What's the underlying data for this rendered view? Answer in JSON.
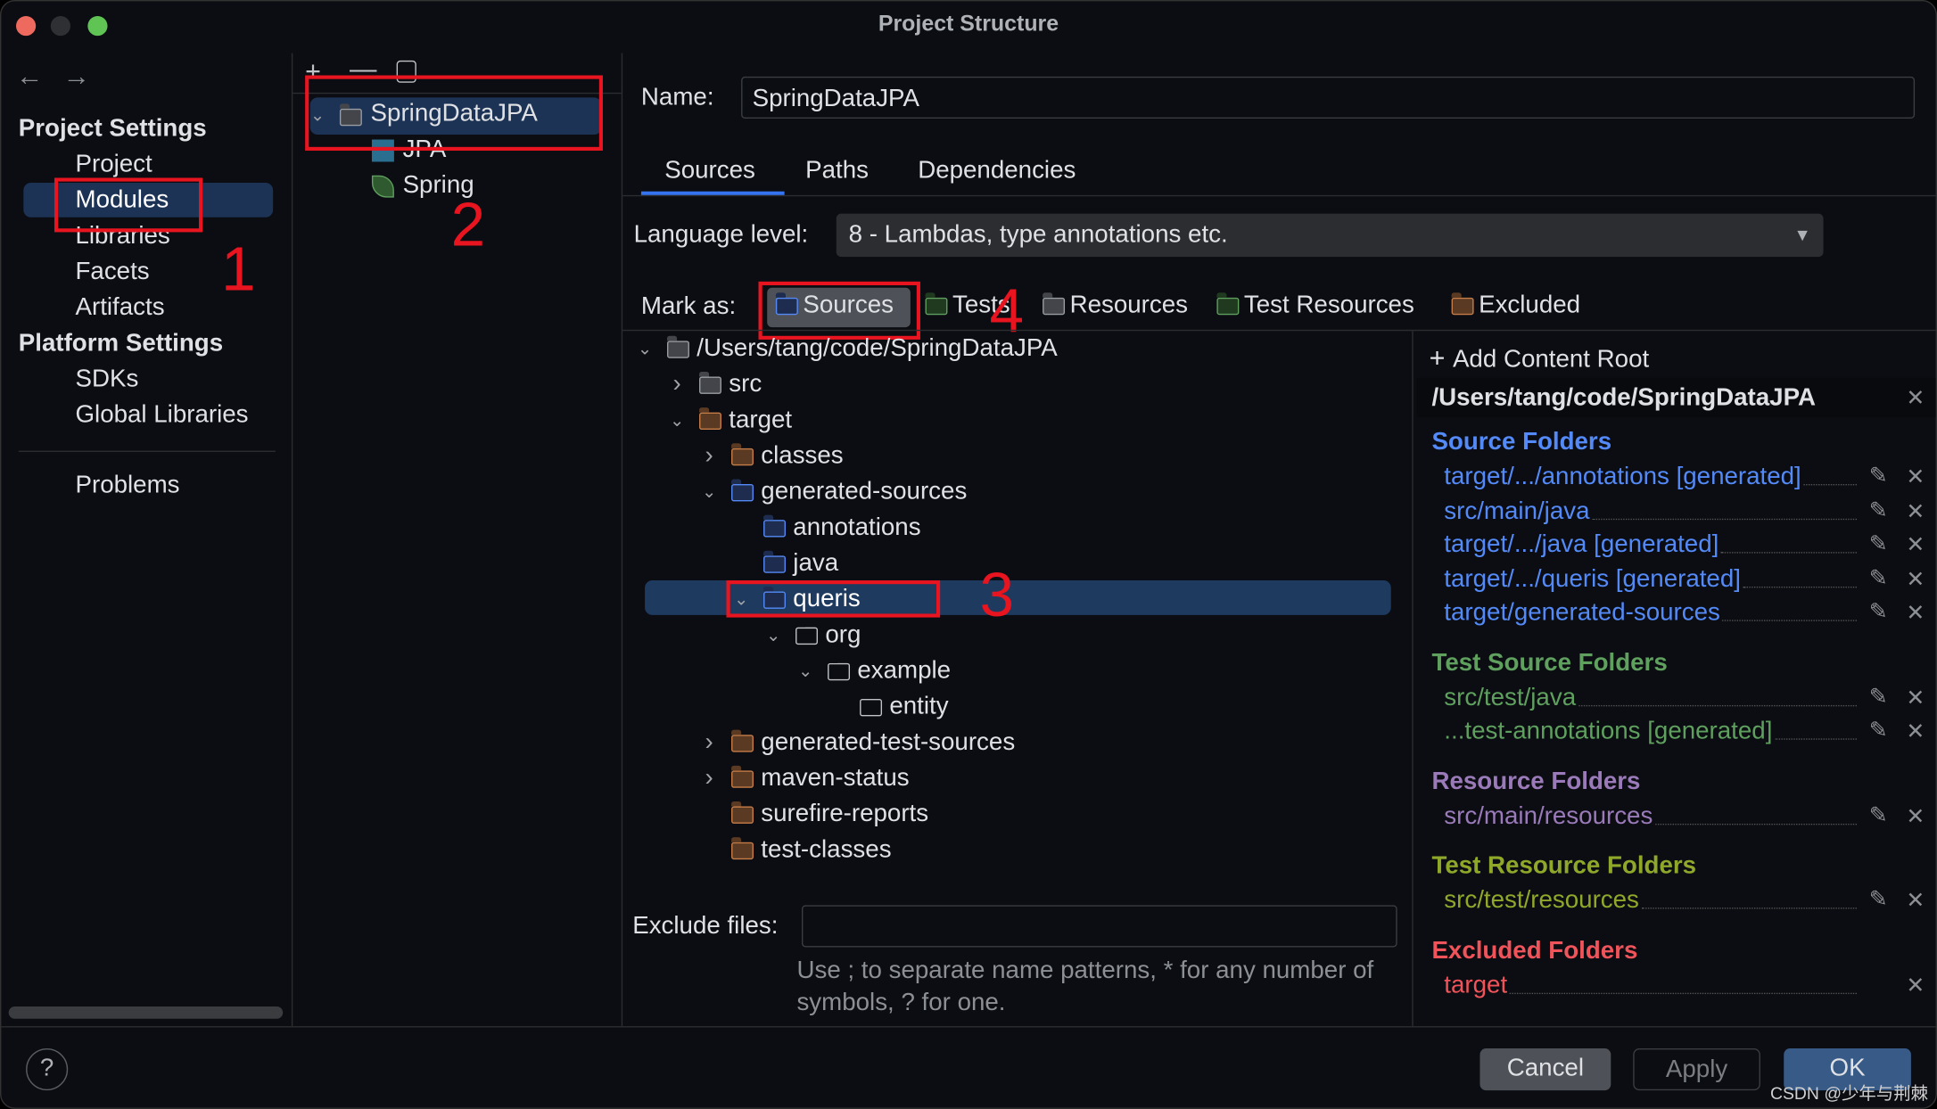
{
  "window": {
    "title": "Project Structure"
  },
  "sidebar": {
    "project_settings_header": "Project Settings",
    "project_items": [
      {
        "label": "Project"
      },
      {
        "label": "Modules",
        "selected": true
      },
      {
        "label": "Libraries"
      },
      {
        "label": "Facets"
      },
      {
        "label": "Artifacts"
      }
    ],
    "platform_settings_header": "Platform Settings",
    "platform_items": [
      {
        "label": "SDKs"
      },
      {
        "label": "Global Libraries"
      }
    ],
    "problems": "Problems"
  },
  "modules": {
    "items": [
      {
        "label": "SpringDataJPA",
        "selected": true
      },
      {
        "label": "JPA"
      },
      {
        "label": "Spring"
      }
    ]
  },
  "annotations": [
    "1",
    "2",
    "3",
    "4"
  ],
  "main": {
    "name_label": "Name:",
    "name_value": "SpringDataJPA",
    "tabs": [
      {
        "label": "Sources",
        "active": true
      },
      {
        "label": "Paths"
      },
      {
        "label": "Dependencies"
      }
    ],
    "language_label": "Language level:",
    "language_value": "8 - Lambdas, type annotations etc.",
    "mark_as_label": "Mark as:",
    "mark_buttons": [
      "Sources",
      "Tests",
      "Resources",
      "Test Resources",
      "Excluded"
    ],
    "tree": [
      {
        "label": "/Users/tang/code/SpringDataJPA",
        "depth": 0,
        "state": "expanded",
        "icon": "folder"
      },
      {
        "label": "src",
        "depth": 1,
        "state": "collapsed",
        "icon": "folder"
      },
      {
        "label": "target",
        "depth": 1,
        "state": "expanded",
        "icon": "excluded-folder"
      },
      {
        "label": "classes",
        "depth": 2,
        "state": "collapsed",
        "icon": "excluded-folder"
      },
      {
        "label": "generated-sources",
        "depth": 2,
        "state": "expanded",
        "icon": "source-folder"
      },
      {
        "label": "annotations",
        "depth": 3,
        "state": "leaf",
        "icon": "generated-source-folder"
      },
      {
        "label": "java",
        "depth": 3,
        "state": "leaf",
        "icon": "generated-source-folder"
      },
      {
        "label": "queris",
        "depth": 3,
        "state": "expanded",
        "icon": "generated-source-folder",
        "selected": true
      },
      {
        "label": "org",
        "depth": 4,
        "state": "expanded",
        "icon": "package"
      },
      {
        "label": "example",
        "depth": 5,
        "state": "expanded",
        "icon": "package"
      },
      {
        "label": "entity",
        "depth": 6,
        "state": "leaf",
        "icon": "package"
      },
      {
        "label": "generated-test-sources",
        "depth": 2,
        "state": "collapsed",
        "icon": "excluded-folder"
      },
      {
        "label": "maven-status",
        "depth": 2,
        "state": "collapsed",
        "icon": "excluded-folder"
      },
      {
        "label": "surefire-reports",
        "depth": 2,
        "state": "leaf",
        "icon": "excluded-folder"
      },
      {
        "label": "test-classes",
        "depth": 2,
        "state": "leaf",
        "icon": "excluded-folder"
      }
    ],
    "exclude_label": "Exclude files:",
    "exclude_value": "",
    "exclude_hint": "Use ; to separate name patterns, * for any number of symbols, ? for one."
  },
  "content_root": {
    "add_label": "Add Content Root",
    "path": "/Users/tang/code/SpringDataJPA",
    "groups": [
      {
        "title": "Source Folders",
        "color": "#548af7",
        "items": [
          "target/.../annotations [generated]",
          "src/main/java",
          "target/.../java [generated]",
          "target/.../queris [generated]",
          "target/generated-sources"
        ],
        "editable": true
      },
      {
        "title": "Test Source Folders",
        "color": "#5fa05f",
        "items": [
          "src/test/java",
          "...test-annotations [generated]"
        ],
        "editable": true
      },
      {
        "title": "Resource Folders",
        "color": "#9a7ab8",
        "items": [
          "src/main/resources"
        ],
        "editable": true
      },
      {
        "title": "Test Resource Folders",
        "color": "#8fa82a",
        "items": [
          "src/test/resources"
        ],
        "editable": true
      },
      {
        "title": "Excluded Folders",
        "color": "#f0545a",
        "items": [
          "target"
        ],
        "editable": false
      }
    ]
  },
  "footer": {
    "help": "?",
    "cancel": "Cancel",
    "apply": "Apply",
    "ok": "OK"
  },
  "watermark": "CSDN @少年与荆棘"
}
